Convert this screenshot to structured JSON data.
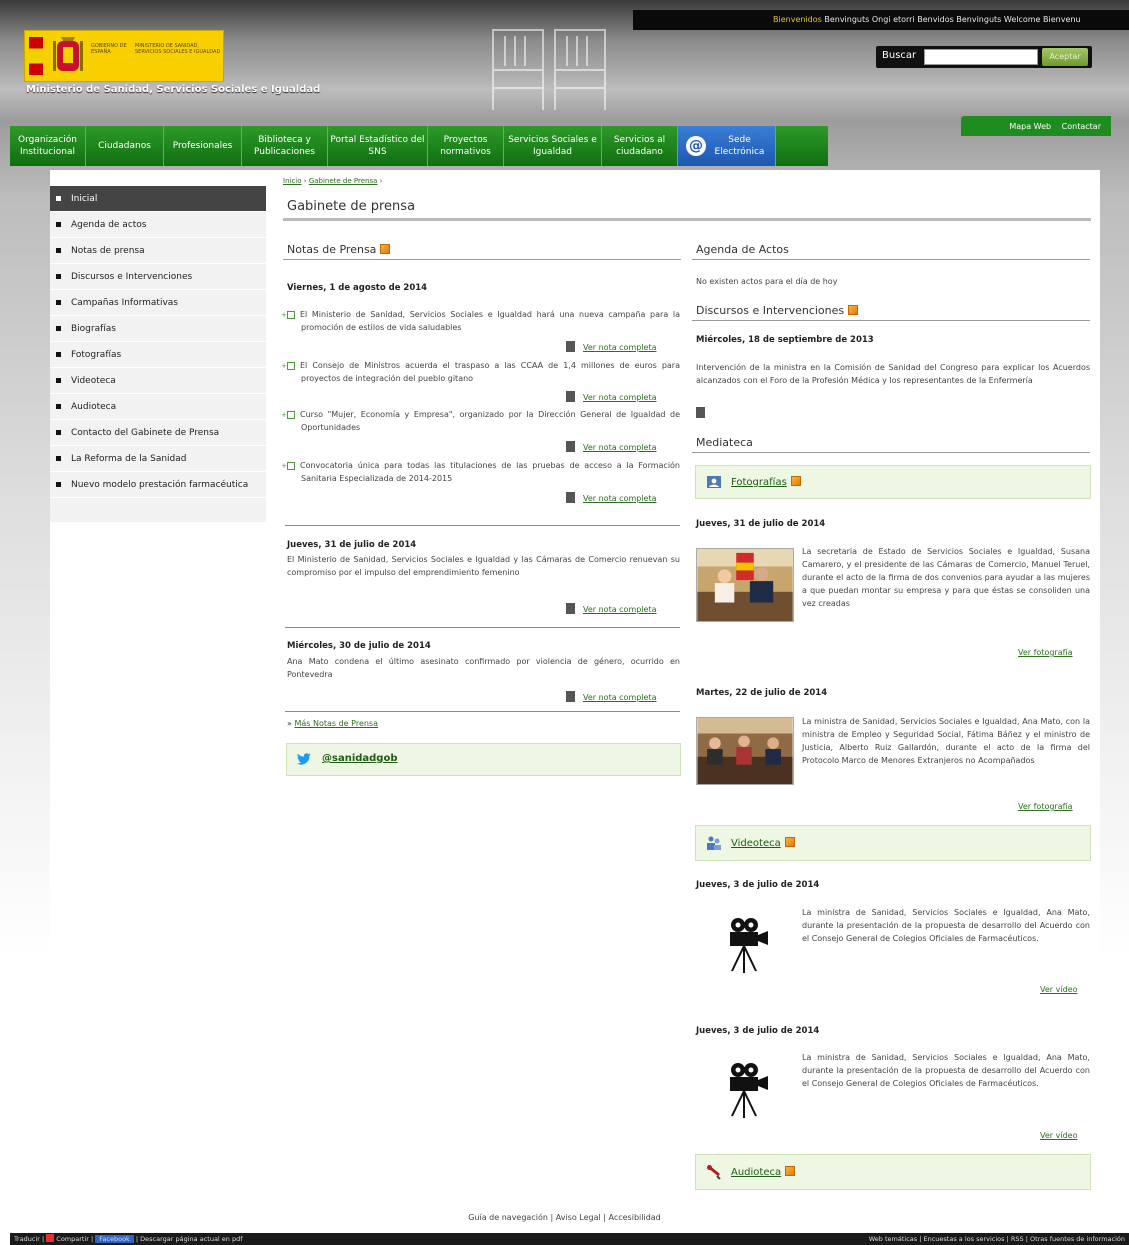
{
  "header": {
    "welcome": [
      "Bienvenidos",
      "Benvinguts",
      "Ongi etorri",
      "Benvidos",
      "Benvinguts",
      "Welcome",
      "Bienvenu"
    ],
    "ministry": "Ministerio de Sanidad, Servicios Sociales e Igualdad",
    "logo_text_1": "GOBIERNO DE ESPAÑA",
    "logo_text_2": "MINISTERIO DE SANIDAD, SERVICIOS SOCIALES E IGUALDAD",
    "search_label": "Buscar",
    "search_value": "",
    "search_button": "Aceptar",
    "mapa_web": "Mapa Web",
    "contactar": "Contactar"
  },
  "nav": [
    {
      "label": "Organización Institucional"
    },
    {
      "label": "Ciudadanos"
    },
    {
      "label": "Profesionales"
    },
    {
      "label": "Biblioteca y Publicaciones"
    },
    {
      "label": "Portal Estadístico del SNS"
    },
    {
      "label": "Proyectos normativos"
    },
    {
      "label": "Servicios Sociales e Igualdad"
    },
    {
      "label": "Servicios al ciudadano"
    },
    {
      "label": "Sede Electrónica"
    }
  ],
  "sidebar": {
    "items": [
      {
        "label": "Inicial"
      },
      {
        "label": "Agenda de actos"
      },
      {
        "label": "Notas de prensa"
      },
      {
        "label": "Discursos e Intervenciones"
      },
      {
        "label": "Campañas Informativas"
      },
      {
        "label": "Biografías"
      },
      {
        "label": "Fotografías"
      },
      {
        "label": "Videoteca"
      },
      {
        "label": "Audioteca"
      },
      {
        "label": "Contacto del Gabinete de Prensa"
      },
      {
        "label": "La Reforma de la Sanidad"
      },
      {
        "label": "Nuevo modelo prestación farmacéutica"
      }
    ]
  },
  "breadcrumb": {
    "home": "Inicio",
    "sep": "›",
    "current": "Gabinete de Prensa"
  },
  "page_title": "Gabinete de prensa",
  "notas": {
    "header": "Notas de Prensa",
    "more_link": "Ver nota completa",
    "group1_date": "Viernes, 1 de agosto de 2014",
    "group1": [
      {
        "text": "El Ministerio de Sanidad, Servicios Sociales e Igualdad hará una nueva campaña para la promoción de estilos de vida saludables"
      },
      {
        "text": "El Consejo de Ministros acuerda el traspaso a las CCAA de 1,4 millones de euros para proyectos de integración del pueblo gitano"
      },
      {
        "text": "Curso \"Mujer, Economía y Empresa\", organizado por la Dirección General de Igualdad de Oportunidades"
      },
      {
        "text": "Convocatoria única para todas las titulaciones de las pruebas de acceso a la Formación Sanitaria Especializada de 2014-2015"
      }
    ],
    "group2_date": "Jueves, 31 de julio de 2014",
    "group2_text": "El Ministerio de Sanidad, Servicios Sociales e Igualdad y las Cámaras de Comercio renuevan su compromiso por el impulso del emprendimiento femenino",
    "group3_date": "Miércoles, 30 de julio de 2014",
    "group3_text": "Ana Mato condena el último asesinato confirmado por violencia de género, ocurrido en Pontevedra",
    "mas_notas": "Más Notas de Prensa",
    "twitter": "@sanidadgob"
  },
  "agenda": {
    "header": "Agenda de Actos",
    "text": "No existen actos para el día de hoy"
  },
  "discursos": {
    "header": "Discursos e Intervenciones",
    "date": "Miércoles, 18 de septiembre de 2013",
    "text": "Intervención de la ministra en la Comisión de Sanidad del Congreso para explicar los Acuerdos alcanzados con el Foro de la Profesión Médica y los representantes de la Enfermería"
  },
  "mediateca": {
    "header": "Mediateca",
    "fotografias": "Fotografías",
    "photo1_date": "Jueves, 31 de julio de 2014",
    "photo1_text": "La secretaria de Estado de Servicios Sociales e Igualdad, Susana Camarero, y el presidente de las Cámaras de Comercio, Manuel Teruel, durante el acto de la firma de dos convenios para ayudar a las mujeres a que puedan montar su empresa y para que éstas se consoliden una vez creadas",
    "ver_fotografia": "Ver fotografía",
    "photo2_date": "Martes, 22 de julio de 2014",
    "photo2_text": "La ministra de Sanidad, Servicios Sociales e Igualdad, Ana Mato, con la ministra de Empleo y Seguridad Social, Fátima Báñez y el ministro de Justicia, Alberto Ruiz Gallardón, durante el acto de la firma del Protocolo Marco de Menores Extranjeros no Acompañados",
    "videoteca": "Videoteca",
    "video1_date": "Jueves, 3 de julio de 2014",
    "video1_text": "La ministra de Sanidad, Servicios Sociales e Igualdad, Ana Mato, durante la presentación de la propuesta de desarrollo del Acuerdo con el Consejo General de Colegios Oficiales de Farmacéuticos.",
    "ver_video": "Ver vídeo",
    "video2_date": "Jueves, 3 de julio de 2014",
    "video2_text": "La ministra de Sanidad, Servicios Sociales e Igualdad, Ana Mato, durante la presentación de la propuesta de desarrollo del Acuerdo con el Consejo General de Colegios Oficiales de Farmacéuticos.",
    "audioteca": "Audioteca"
  },
  "footer": {
    "links": [
      "Guía de navegación",
      "Aviso Legal",
      "Accesibilidad"
    ]
  },
  "bottombar": {
    "left": [
      "Traducir",
      "Compartir",
      "Facebook",
      "Descargar página actual en pdf"
    ],
    "right": [
      "Web temáticas",
      "Encuestas a los servicios",
      "RSS",
      "Otras fuentes de información"
    ]
  },
  "colors": {
    "nav_green": "#1f8c1f",
    "link_green": "#2d6f1f",
    "sede_blue": "#1c57b0"
  }
}
